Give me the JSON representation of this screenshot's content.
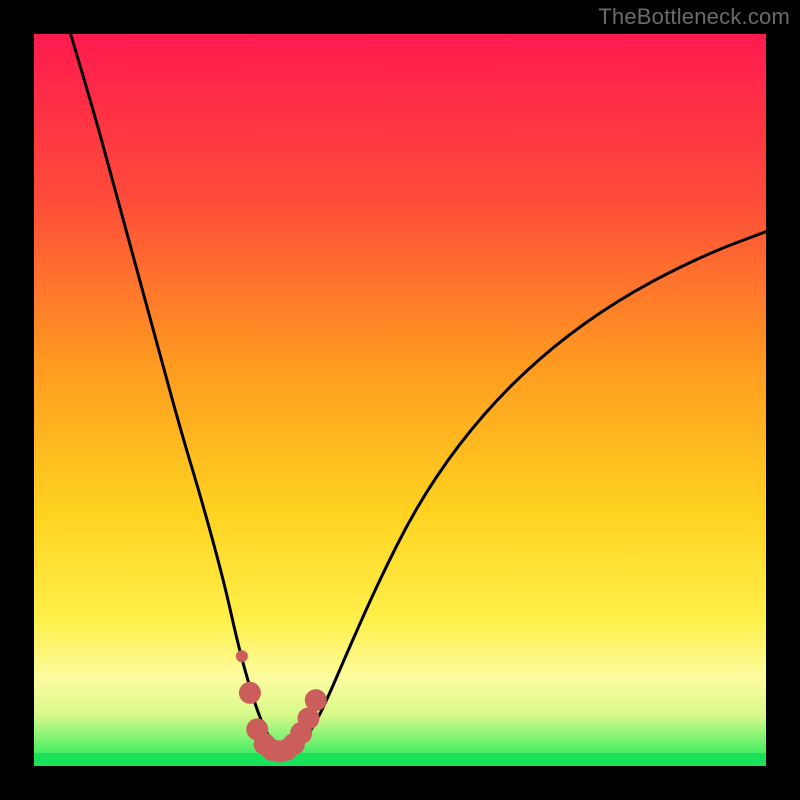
{
  "watermark": "TheBottleneck.com",
  "colors": {
    "frame": "#000000",
    "curve": "#000000",
    "marker": "#cb5d5b",
    "green_band": "#18e358",
    "gradient_top": "#ff1a4f",
    "gradient_mid1": "#ff6a2e",
    "gradient_mid2": "#ffd21f",
    "gradient_mid3": "#fff562",
    "gradient_bottom": "#13e856"
  },
  "chart_data": {
    "type": "line",
    "title": "",
    "xlabel": "",
    "ylabel": "",
    "xlim": [
      0,
      100
    ],
    "ylim": [
      0,
      100
    ],
    "series": [
      {
        "name": "bottleneck-curve",
        "x": [
          5,
          8,
          11,
          14,
          17,
          20,
          23,
          26,
          28,
          30,
          31.5,
          33,
          34.5,
          36,
          38,
          40,
          43,
          47,
          52,
          58,
          65,
          73,
          82,
          92,
          100
        ],
        "y": [
          100,
          90,
          79,
          68,
          57,
          46,
          36,
          25,
          16,
          9,
          5,
          2.5,
          2,
          2.5,
          5,
          9,
          16,
          25,
          35,
          44,
          52,
          59,
          65,
          70,
          73
        ]
      }
    ],
    "markers": {
      "name": "highlight-dots",
      "x": [
        29.5,
        30.5,
        31.5,
        32.5,
        33.5,
        34.5,
        35.5,
        36.5,
        37.5,
        38.5
      ],
      "y": [
        10,
        5,
        3,
        2.2,
        2,
        2.2,
        3,
        4.5,
        6.5,
        9
      ]
    },
    "extra_marker": {
      "x": 28.4,
      "y": 15
    }
  }
}
